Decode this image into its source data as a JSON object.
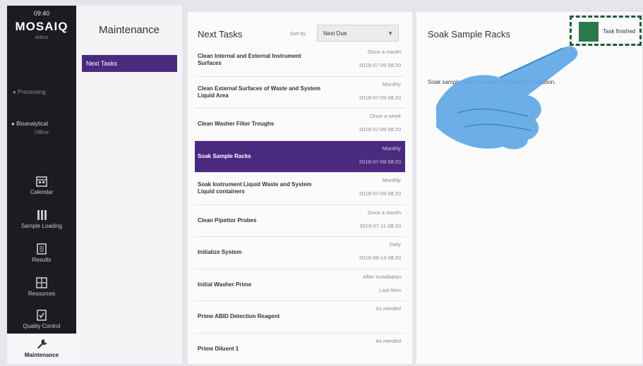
{
  "sidebar": {
    "time": "09:40",
    "logo": "MOSAIQ",
    "logo_sub": "status",
    "status": "Processing",
    "user": "Bioanalytical",
    "user_sub": "Offline",
    "nav": [
      {
        "label": "Calendar",
        "icon": "calendar-icon"
      },
      {
        "label": "Sample Loading",
        "icon": "sample-loading-icon"
      },
      {
        "label": "Results",
        "icon": "results-icon"
      },
      {
        "label": "Resources",
        "icon": "resources-icon"
      },
      {
        "label": "Quality Control",
        "icon": "quality-control-icon"
      }
    ],
    "active": {
      "label": "Maintenance",
      "icon": "wrench-icon"
    }
  },
  "maintenance": {
    "title": "Maintenance",
    "items": [
      "Next Tasks"
    ]
  },
  "tasks": {
    "title": "Next Tasks",
    "sort_label": "Sort by",
    "sort_value": "Next Due",
    "rows": [
      {
        "name": "Clean Internal and External Instrument Surfaces",
        "freq": "Once a month",
        "due": "2019-07-09 08:20",
        "selected": false
      },
      {
        "name": "Clean External Surfaces of Waste and System Liquid Area",
        "freq": "Monthly",
        "due": "2019-07-09 08:20",
        "selected": false
      },
      {
        "name": "Clean Washer Filter Troughs",
        "freq": "Once a week",
        "due": "2019-07-09 08:20",
        "selected": false
      },
      {
        "name": "Soak Sample Racks",
        "freq": "Monthly",
        "due": "2019-07-09 08:20",
        "selected": true
      },
      {
        "name": "Soak Instrument Liquid Waste and System Liquid containers",
        "freq": "Monthly",
        "due": "2019-07-09 08:20",
        "selected": false
      },
      {
        "name": "Clean Pipettor Probes",
        "freq": "Once a month",
        "due": "2019-07-11 08:20",
        "selected": false
      },
      {
        "name": "Initialize System",
        "freq": "Daily",
        "due": "2019-08-14 08:20",
        "selected": false
      },
      {
        "name": "Initial Washer Prime",
        "freq": "After Installation",
        "due": "Last Item",
        "selected": false
      },
      {
        "name": "Prime ABID Detection Reagent",
        "freq": "As needed",
        "due": "",
        "selected": false
      },
      {
        "name": "Prime Diluent 1",
        "freq": "As needed",
        "due": "",
        "selected": false
      }
    ]
  },
  "detail": {
    "title": "Soak Sample Racks",
    "description": "Soak sample racks in water and detergent solution.",
    "check_label": "Task finished"
  },
  "colors": {
    "accent": "#4a2a7e",
    "sidebar_bg": "#1c1c20",
    "check_green": "#2a7a4a",
    "highlight": "#1d5e34"
  }
}
